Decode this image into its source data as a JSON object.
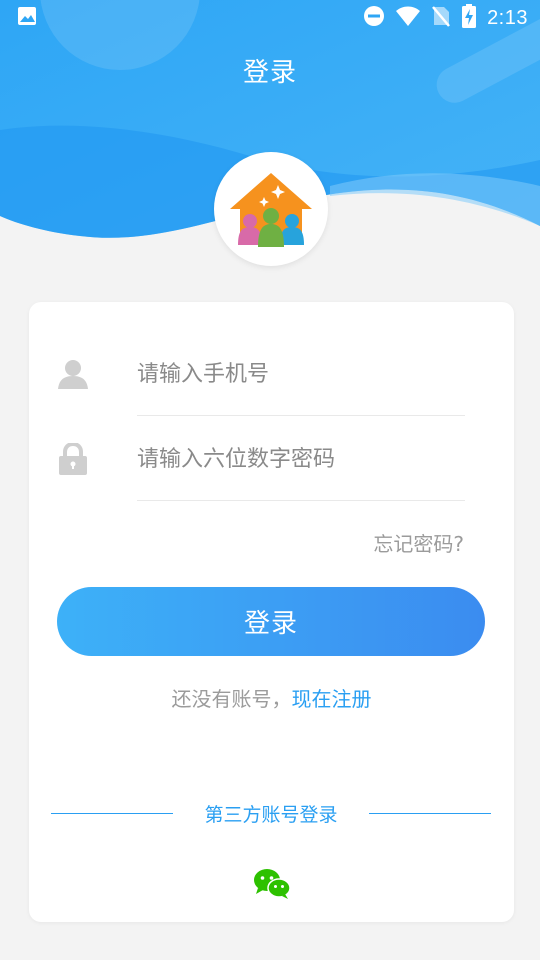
{
  "status_bar": {
    "time": "2:13",
    "icons": [
      "image-icon",
      "dnd-icon",
      "wifi-icon",
      "no-sim-icon",
      "battery-charging-icon"
    ]
  },
  "header": {
    "title": "登录"
  },
  "form": {
    "phone_placeholder": "请输入手机号",
    "password_placeholder": "请输入六位数字密码",
    "forgot_label": "忘记密码?",
    "login_label": "登录",
    "register_prompt": "还没有账号，",
    "register_link": "现在注册",
    "third_party_label": "第三方账号登录",
    "third_party_icons": [
      "wechat-icon"
    ]
  },
  "colors": {
    "primary": "#2a9ff2",
    "button_start": "#3db1f8",
    "button_end": "#3b8cf0",
    "background": "#f3f3f3"
  }
}
